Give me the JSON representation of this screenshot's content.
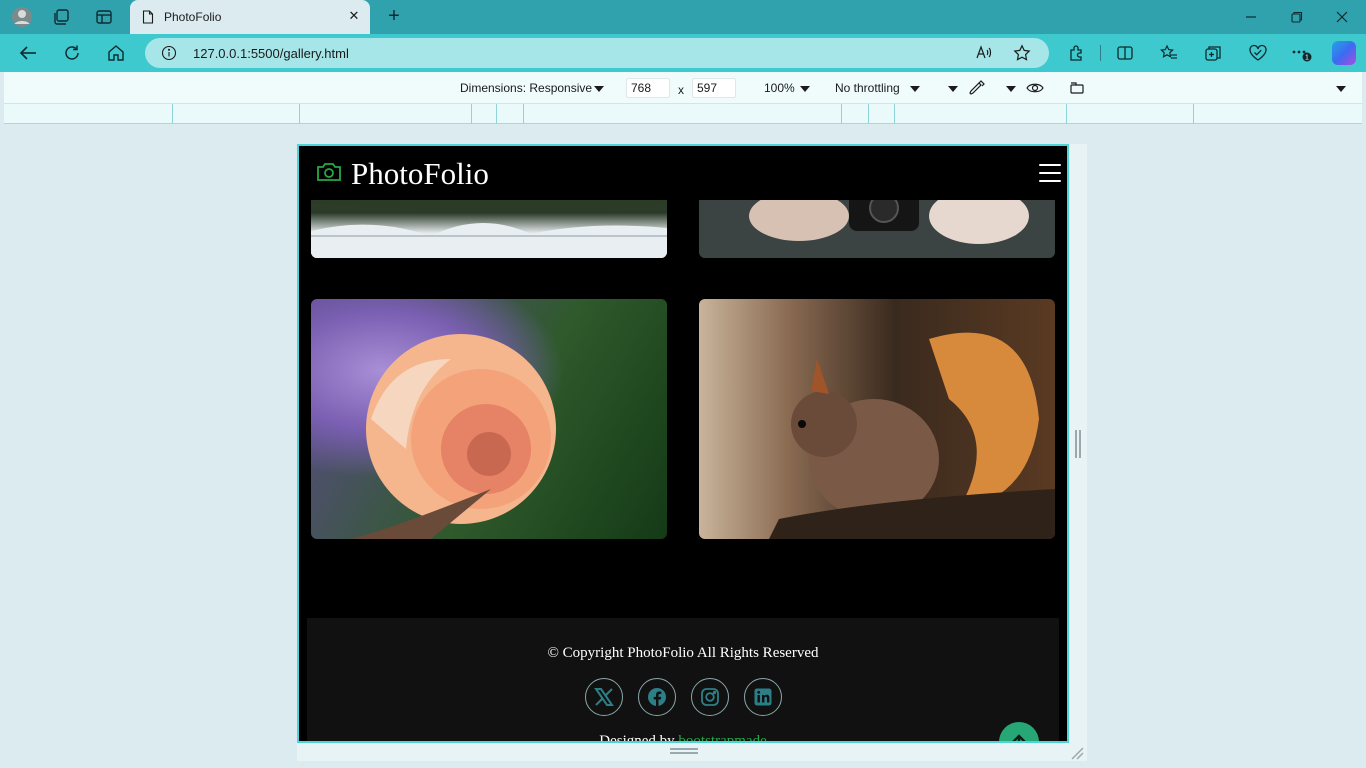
{
  "browser": {
    "tab_title": "PhotoFolio",
    "url": "127.0.0.1:5500/gallery.html",
    "extensions_badge": "1"
  },
  "devtools": {
    "dimensions_label": "Dimensions: Responsive",
    "width_value": "768",
    "height_value": "597",
    "times": "x",
    "zoom": "100%",
    "throttling": "No throttling"
  },
  "site": {
    "logo_text": "PhotoFolio",
    "accent_color": "#27a844",
    "gallery": [
      {
        "alt": "mountain lake reflection"
      },
      {
        "alt": "person holding camera"
      },
      {
        "alt": "peach rose"
      },
      {
        "alt": "red squirrel"
      }
    ],
    "footer": {
      "copyright": "© Copyright PhotoFolio All Rights Reserved",
      "social": [
        "x-icon",
        "facebook-icon",
        "instagram-icon",
        "linkedin-icon"
      ],
      "designed_by_prefix": "Designed by ",
      "designed_by_link": "bootstrapmade"
    }
  }
}
